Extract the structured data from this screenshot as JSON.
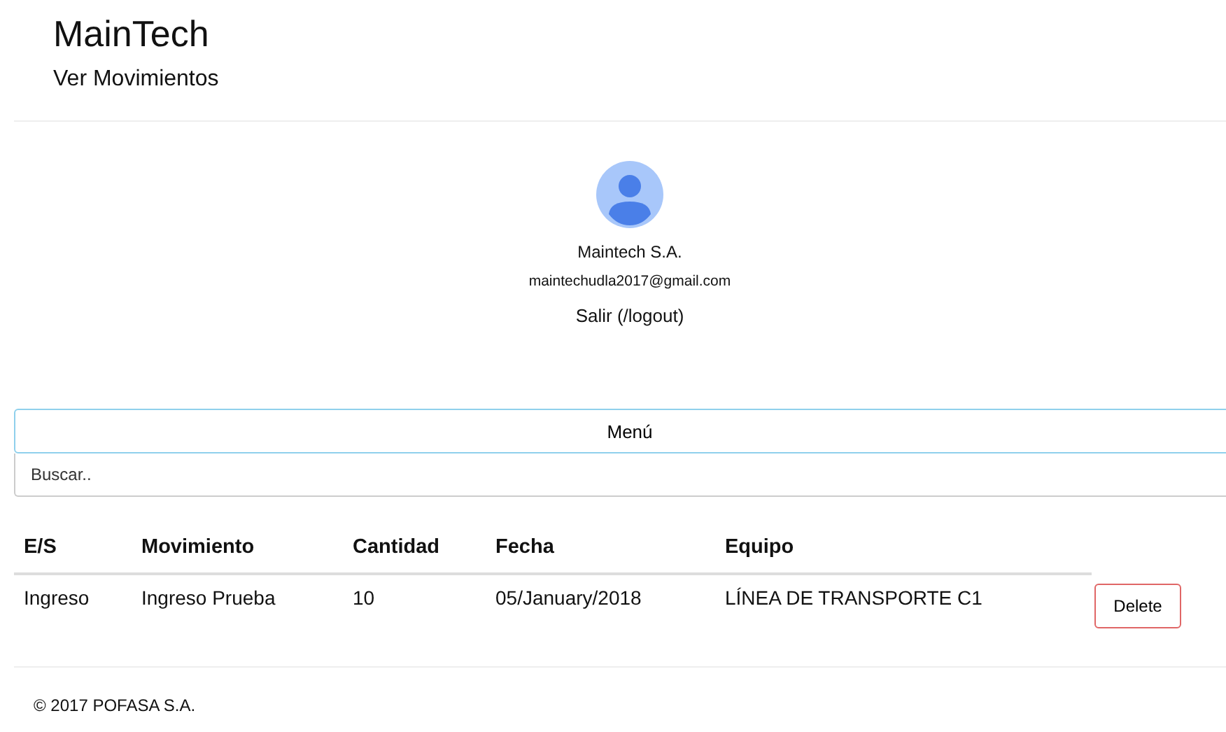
{
  "header": {
    "title": "MainTech",
    "subtitle": "Ver Movimientos"
  },
  "profile": {
    "name": "Maintech S.A.",
    "email": "maintechudla2017@gmail.com",
    "logout": "Salir (/logout)"
  },
  "menu": {
    "label": "Menú"
  },
  "search": {
    "placeholder": "Buscar.."
  },
  "table": {
    "columns": [
      "E/S",
      "Movimiento",
      "Cantidad",
      "Fecha",
      "Equipo"
    ],
    "rows": [
      {
        "cells": [
          "Ingreso",
          "Ingreso Prueba",
          "10",
          "05/January/2018",
          "LÍNEA DE TRANSPORTE C1"
        ],
        "action": "Delete"
      }
    ]
  },
  "footer": "© 2017 POFASA S.A."
}
